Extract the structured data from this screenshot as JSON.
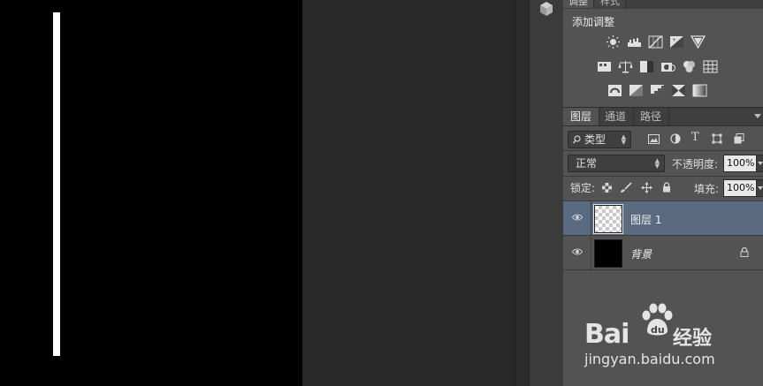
{
  "adjustments_panel": {
    "tabs": [
      "调整",
      "样式"
    ],
    "title": "添加调整",
    "rows": [
      [
        "brightness-contrast-icon",
        "levels-icon",
        "curves-icon",
        "exposure-icon",
        "vibrance-icon"
      ],
      [
        "hue-saturation-icon",
        "color-balance-icon",
        "black-white-icon",
        "photo-filter-icon",
        "channel-mixer-icon",
        "color-lookup-icon"
      ],
      [
        "invert-icon",
        "posterize-icon",
        "threshold-icon",
        "selective-color-icon",
        "gradient-map-icon"
      ]
    ]
  },
  "layers_panel": {
    "tabs": [
      "图层",
      "通道",
      "路径"
    ],
    "filter": {
      "label": "类型"
    },
    "filter_icons": [
      "image-filter-icon",
      "adjustment-filter-icon",
      "text-filter-icon",
      "shape-filter-icon",
      "smart-object-filter-icon"
    ],
    "blend_mode": "正常",
    "opacity_label": "不透明度:",
    "opacity_value": "100%",
    "lock_label": "锁定:",
    "lock_icons": [
      "lock-transparent-icon",
      "lock-image-icon",
      "lock-position-icon",
      "lock-all-icon"
    ],
    "fill_label": "填充:",
    "fill_value": "100%",
    "layers": [
      {
        "name": "图层 1",
        "selected": true,
        "thumbnail": "transparent"
      },
      {
        "name": "背景",
        "selected": false,
        "thumbnail": "black",
        "locked": true
      }
    ]
  },
  "watermark": {
    "brand": "Bai",
    "brand_suffix": "经验",
    "url": "jingyan.baidu.com"
  },
  "colors": {
    "canvas": "#000000",
    "stroke": "#ffffff",
    "panel": "#535353",
    "selected_layer": "#5a6a80"
  }
}
